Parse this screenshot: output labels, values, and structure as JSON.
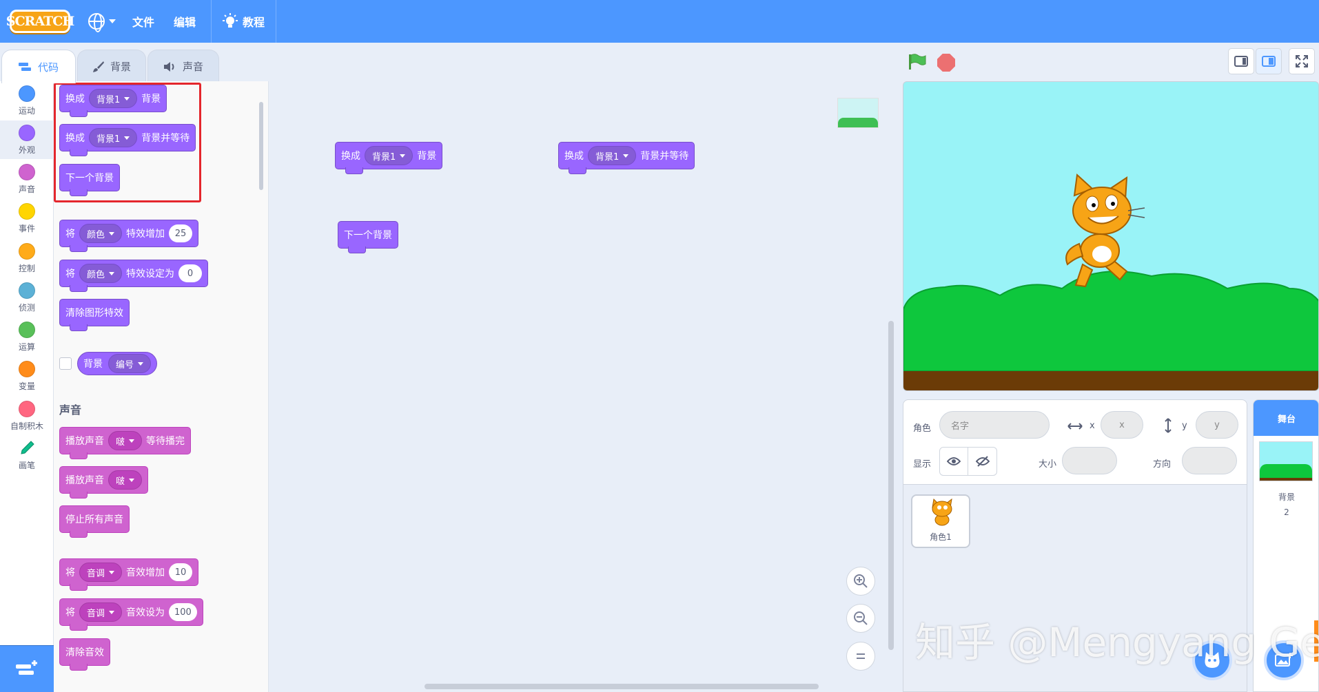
{
  "menubar": {
    "logo": "SCRATCH",
    "file": "文件",
    "edit": "编辑",
    "tutorials": "教程"
  },
  "tabs": {
    "code": "代码",
    "backdrops": "背景",
    "sounds": "声音"
  },
  "categories": [
    {
      "label": "运动",
      "color": "#4c97ff"
    },
    {
      "label": "外观",
      "color": "#9966ff"
    },
    {
      "label": "声音",
      "color": "#cf63cf"
    },
    {
      "label": "事件",
      "color": "#ffd500"
    },
    {
      "label": "控制",
      "color": "#ffab19"
    },
    {
      "label": "侦测",
      "color": "#5cb1d6"
    },
    {
      "label": "运算",
      "color": "#59c059"
    },
    {
      "label": "变量",
      "color": "#ff8c1a"
    },
    {
      "label": "自制积木",
      "color": "#ff6680"
    },
    {
      "label": "画笔",
      "color": "#0fbd8c"
    }
  ],
  "palette": {
    "switch_backdrop": {
      "pre": "换成",
      "dd": "背景1",
      "post": "背景"
    },
    "switch_backdrop_wait": {
      "pre": "换成",
      "dd": "背景1",
      "post": "背景并等待"
    },
    "next_backdrop": "下一个背景",
    "change_effect": {
      "pre": "将",
      "dd": "颜色",
      "mid": "特效增加",
      "num": "25"
    },
    "set_effect": {
      "pre": "将",
      "dd": "颜色",
      "mid": "特效设定为",
      "num": "0"
    },
    "clear_effects": "清除图形特效",
    "backdrop_reporter": {
      "label": "背景",
      "dd": "编号"
    },
    "sound_heading": "声音",
    "play_until_done": {
      "pre": "播放声音",
      "dd": "啵",
      "post": "等待播完"
    },
    "start_sound": {
      "pre": "播放声音",
      "dd": "啵"
    },
    "stop_all_sounds": "停止所有声音",
    "change_sound_effect": {
      "pre": "将",
      "dd": "音调",
      "mid": "音效增加",
      "num": "10"
    },
    "set_sound_effect": {
      "pre": "将",
      "dd": "音调",
      "mid": "音效设为",
      "num": "100"
    },
    "clear_sound_effects": "清除音效"
  },
  "workspace": {
    "b1": {
      "pre": "换成",
      "dd": "背景1",
      "post": "背景"
    },
    "b2": {
      "pre": "换成",
      "dd": "背景1",
      "post": "背景并等待"
    },
    "b3": "下一个背景"
  },
  "sprite_info": {
    "sprite_label": "角色",
    "name_placeholder": "名字",
    "x_label": "x",
    "x_placeholder": "x",
    "y_label": "y",
    "y_placeholder": "y",
    "show_label": "显示",
    "size_label": "大小",
    "direction_label": "方向"
  },
  "sprites": [
    {
      "name": "角色1"
    }
  ],
  "stage_panel": {
    "header": "舞台",
    "backdrops_label": "背景",
    "backdrops_count": "2"
  },
  "watermark": "知乎 @Mengyang Ge",
  "colors": {
    "menubar": "#4c97ff",
    "looks": "#9966ff",
    "sound": "#cf63cf",
    "highlight": "#e4262c"
  }
}
